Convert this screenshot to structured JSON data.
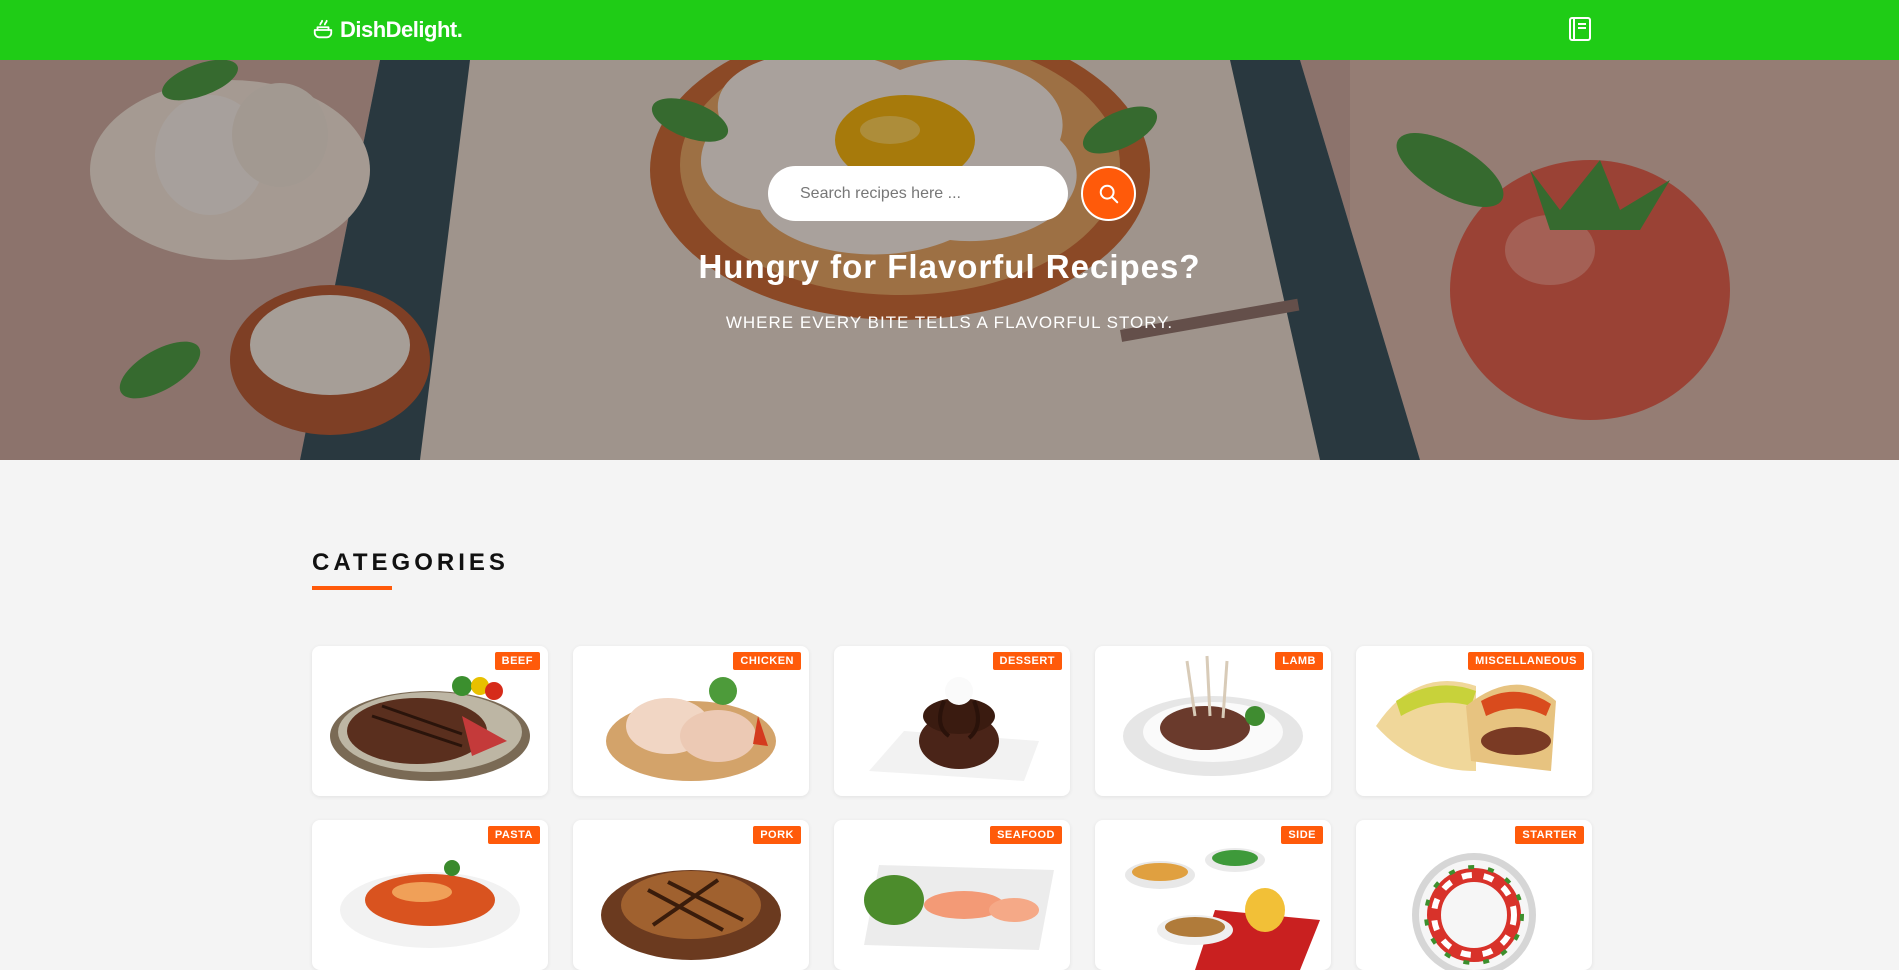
{
  "navbar": {
    "brand": "DishDelight.",
    "brand_icon": "recipe-pot-icon",
    "book_icon": "recipe-book-icon",
    "bg_color": "#1fcc16"
  },
  "hero": {
    "search_placeholder": "Search recipes here ...",
    "search_icon": "search-icon",
    "title": "Hungry for Flavorful Recipes?",
    "subtitle": "WHERE EVERY BITE TELLS A FLAVORFUL STORY.",
    "accent_color": "#ff5a0a"
  },
  "categories": {
    "title": "CATEGORIES",
    "items": [
      {
        "label": "BEEF",
        "image": "steak-plate"
      },
      {
        "label": "CHICKEN",
        "image": "raw-chicken-legs"
      },
      {
        "label": "DESSERT",
        "image": "chocolate-cake"
      },
      {
        "label": "LAMB",
        "image": "lamb-chops"
      },
      {
        "label": "MISCELLANEOUS",
        "image": "tacos"
      },
      {
        "label": "PASTA",
        "image": "penne-bowl"
      },
      {
        "label": "PORK",
        "image": "pork-chop-board"
      },
      {
        "label": "SEAFOOD",
        "image": "salmon-platter"
      },
      {
        "label": "SIDE",
        "image": "side-dishes"
      },
      {
        "label": "STARTER",
        "image": "caprese-wreath"
      }
    ]
  }
}
